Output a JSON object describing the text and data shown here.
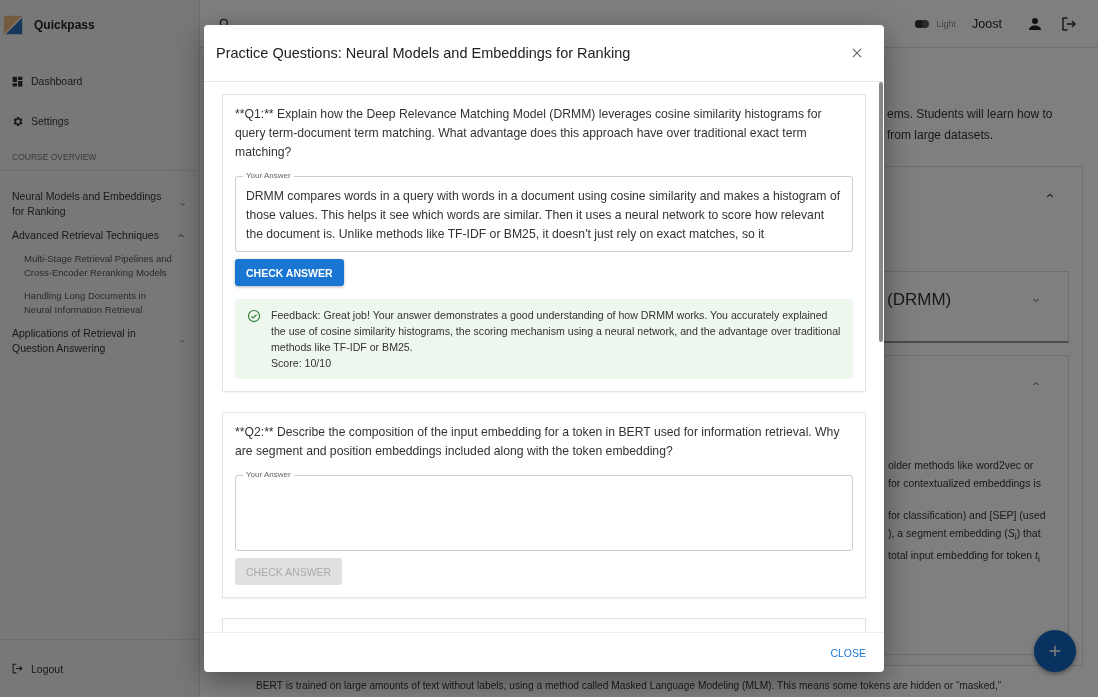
{
  "app": {
    "name": "Quickpass"
  },
  "sidebar": {
    "nav": [
      {
        "label": "Dashboard",
        "kind": "dashboard"
      },
      {
        "label": "Settings",
        "kind": "settings"
      }
    ],
    "section_title": "COURSE OVERVIEW",
    "courses": [
      {
        "label": "Neural Models and Embeddings for Ranking",
        "expanded": false
      },
      {
        "label": "Advanced Retrieval Techniques",
        "expanded": true,
        "children": [
          {
            "label": "Multi-Stage Retrieval Pipelines and Cross-Encoder Reranking Models"
          },
          {
            "label": "Handling Long Documents in Neural Information Retrieval"
          }
        ]
      },
      {
        "label": "Applications of Retrieval in Question Answering",
        "expanded": false
      }
    ],
    "logout": "Logout"
  },
  "topbar": {
    "theme_label": "Light",
    "theme_dark": false,
    "user": "Joost"
  },
  "page": {
    "intro": [
      "ems. Students will learn how to",
      "from large datasets."
    ],
    "module": {
      "expanded": true,
      "sections": [
        {
          "title": "(DRMM)",
          "expanded": false
        },
        {
          "expanded": true,
          "paragraphs": [
            [
              "older methods like word2vec or",
              "for contextualized embeddings is"
            ],
            [
              "for classification) and [SEP] (used",
              "), a segment embedding (*S*$_{i}$) that",
              "total input embedding for token *t*$_{i}$"
            ]
          ]
        }
      ]
    },
    "footer_text": "BERT is trained on large amounts of text without labels, using a method called Masked Language Modeling (MLM). This means some tokens are hidden or “masked,”"
  },
  "dialog": {
    "title": "Practice Questions: Neural Models and Embeddings for Ranking",
    "questions": [
      {
        "text": "**Q1:** Explain how the Deep Relevance Matching Model (DRMM) leverages cosine similarity histograms for query term-document term matching. What advantage does this approach have over traditional exact term matching?",
        "answer_label": "Your Answer",
        "answer": "DRMM compares words in a query with words in a document using cosine similarity and makes a histogram of those values. This helps it see which words are similar. Then it uses a neural network to score how relevant the document is. Unlike methods like TF-IDF or BM25, it doesn't just rely on exact matches, so it",
        "button": {
          "label": "CHECK ANSWER",
          "disabled": false
        },
        "feedback": {
          "text": "Feedback: Great job! Your answer demonstrates a good understanding of how DRMM works. You accurately explained the use of cosine similarity histograms, the scoring mechanism using a neural network, and the advantage over traditional methods like TF-IDF or BM25.",
          "score": "Score: 10/10"
        }
      },
      {
        "text": "**Q2:** Describe the composition of the input embedding for a token in BERT used for information retrieval. Why are segment and position embeddings included along with the token embedding?",
        "answer_label": "Your Answer",
        "button": {
          "label": "CHECK ANSWER",
          "disabled": true
        }
      }
    ],
    "close": "CLOSE"
  }
}
